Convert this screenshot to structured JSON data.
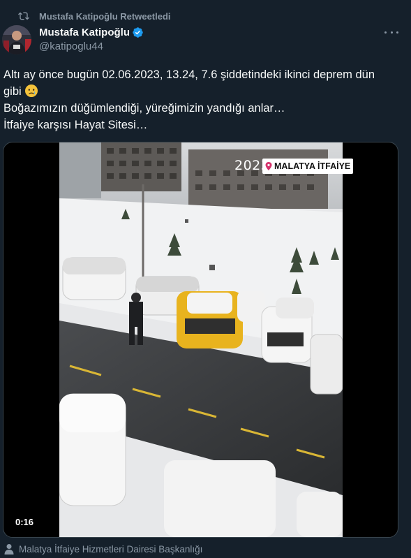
{
  "retweet": {
    "label": "Mustafa Katipoğlu Retweetledi",
    "icon": "retweet-icon"
  },
  "author": {
    "name": "Mustafa Katipoğlu",
    "handle": "@katipoglu44",
    "verified": true,
    "avatar_icon": "avatar-photo",
    "verified_icon": "verified-badge-icon"
  },
  "tweet": {
    "lines": [
      "Altı ay önce bugün 02.06.2023, 13.24, 7.6 şiddetindeki ikinci deprem dün",
      "gibi",
      "Boğazımızın düğümlendiği, yüreğimizin yandığı anlar…",
      "İtfaiye karşısı Hayat Sitesi…"
    ],
    "emoji": "crying-face"
  },
  "media": {
    "timestamp": "2023-02-06",
    "location": "MALATYA İTFAİYE",
    "duration": "0:16",
    "pin_icon": "location-pin-icon"
  },
  "source": {
    "label": "Malatya İtfaiye Hizmetleri Dairesi Başkanlığı",
    "icon": "person-icon"
  },
  "colors": {
    "background": "#15202b",
    "text": "#f7f9f9",
    "muted": "#8b98a5",
    "verified": "#1d9bf0",
    "taxi_yellow": "#e8b31e"
  }
}
